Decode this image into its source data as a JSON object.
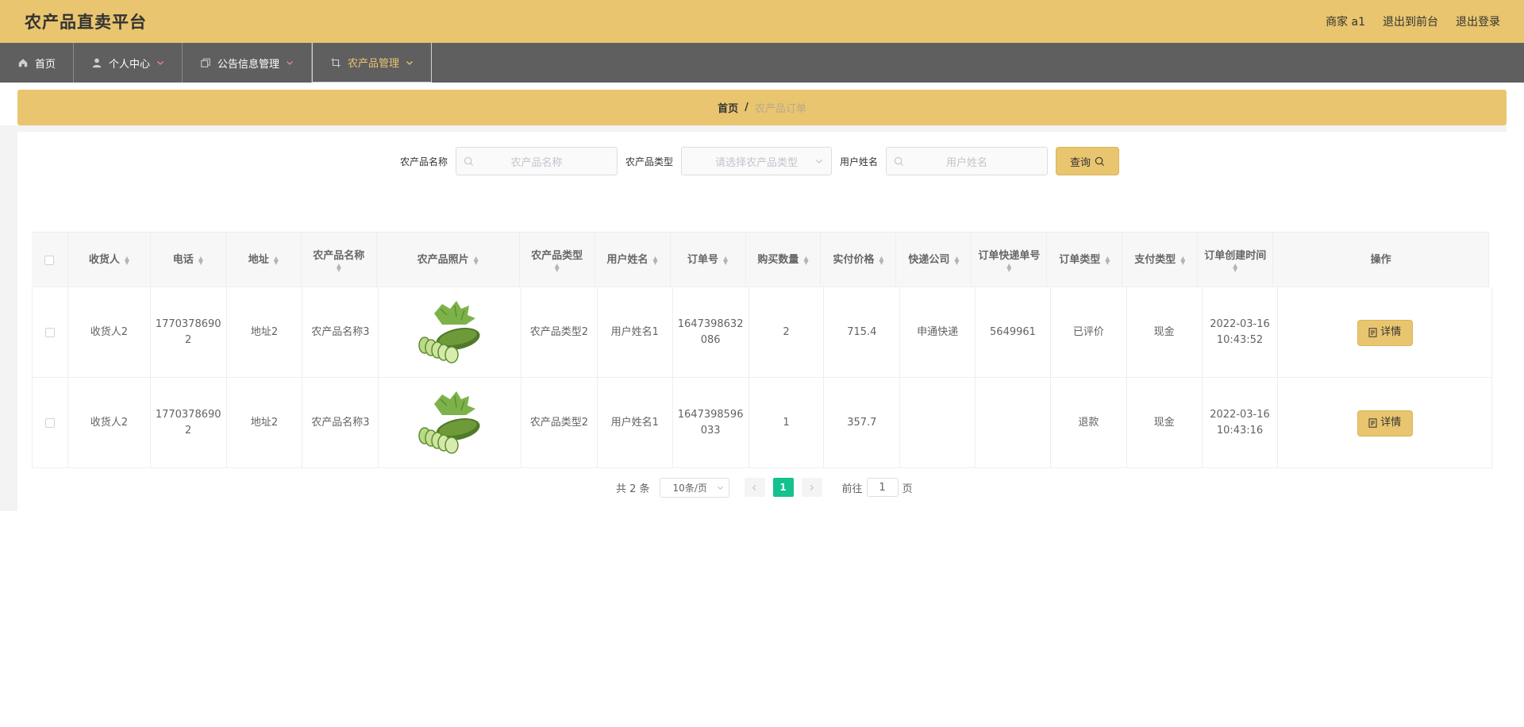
{
  "header": {
    "brand": "农产品直卖平台",
    "user_label": "商家 a1",
    "to_front": "退出到前台",
    "logout": "退出登录"
  },
  "nav": {
    "items": [
      {
        "label": "首页",
        "icon": "home-icon"
      },
      {
        "label": "个人中心",
        "icon": "user-icon"
      },
      {
        "label": "公告信息管理",
        "icon": "copy-icon"
      },
      {
        "label": "农产品管理",
        "icon": "crop-icon"
      }
    ]
  },
  "breadcrumb": {
    "home": "首页",
    "sep": "/",
    "current": "农产品订单"
  },
  "search": {
    "name_label": "农产品名称",
    "name_placeholder": "农产品名称",
    "type_label": "农产品类型",
    "type_placeholder": "请选择农产品类型",
    "user_label": "用户姓名",
    "user_placeholder": "用户姓名",
    "query_button": "查询"
  },
  "table": {
    "headers": [
      "收货人",
      "电话",
      "地址",
      "农产品名称",
      "农产品照片",
      "农产品类型",
      "用户姓名",
      "订单号",
      "购买数量",
      "实付价格",
      "快递公司",
      "订单快递单号",
      "订单类型",
      "支付类型",
      "订单创建时间",
      "操作"
    ],
    "detail_button": "详情",
    "rows": [
      {
        "receiver": "收货人2",
        "phone": "17703786902",
        "address": "地址2",
        "product": "农产品名称3",
        "type": "农产品类型2",
        "user": "用户姓名1",
        "order_no": "1647398632086",
        "qty": "2",
        "price": "715.4",
        "courier": "申通快递",
        "tracking": "5649961",
        "order_type": "已评价",
        "pay_type": "现金",
        "created": "2022-03-16 10:43:52"
      },
      {
        "receiver": "收货人2",
        "phone": "17703786902",
        "address": "地址2",
        "product": "农产品名称3",
        "type": "农产品类型2",
        "user": "用户姓名1",
        "order_no": "1647398596033",
        "qty": "1",
        "price": "357.7",
        "courier": "",
        "tracking": "",
        "order_type": "退款",
        "pay_type": "现金",
        "created": "2022-03-16 10:43:16"
      }
    ]
  },
  "pagination": {
    "total_text": "共 2 条",
    "page_size": "10条/页",
    "current_page": "1",
    "goto_label": "前往",
    "goto_value": "1",
    "page_suffix": "页"
  }
}
